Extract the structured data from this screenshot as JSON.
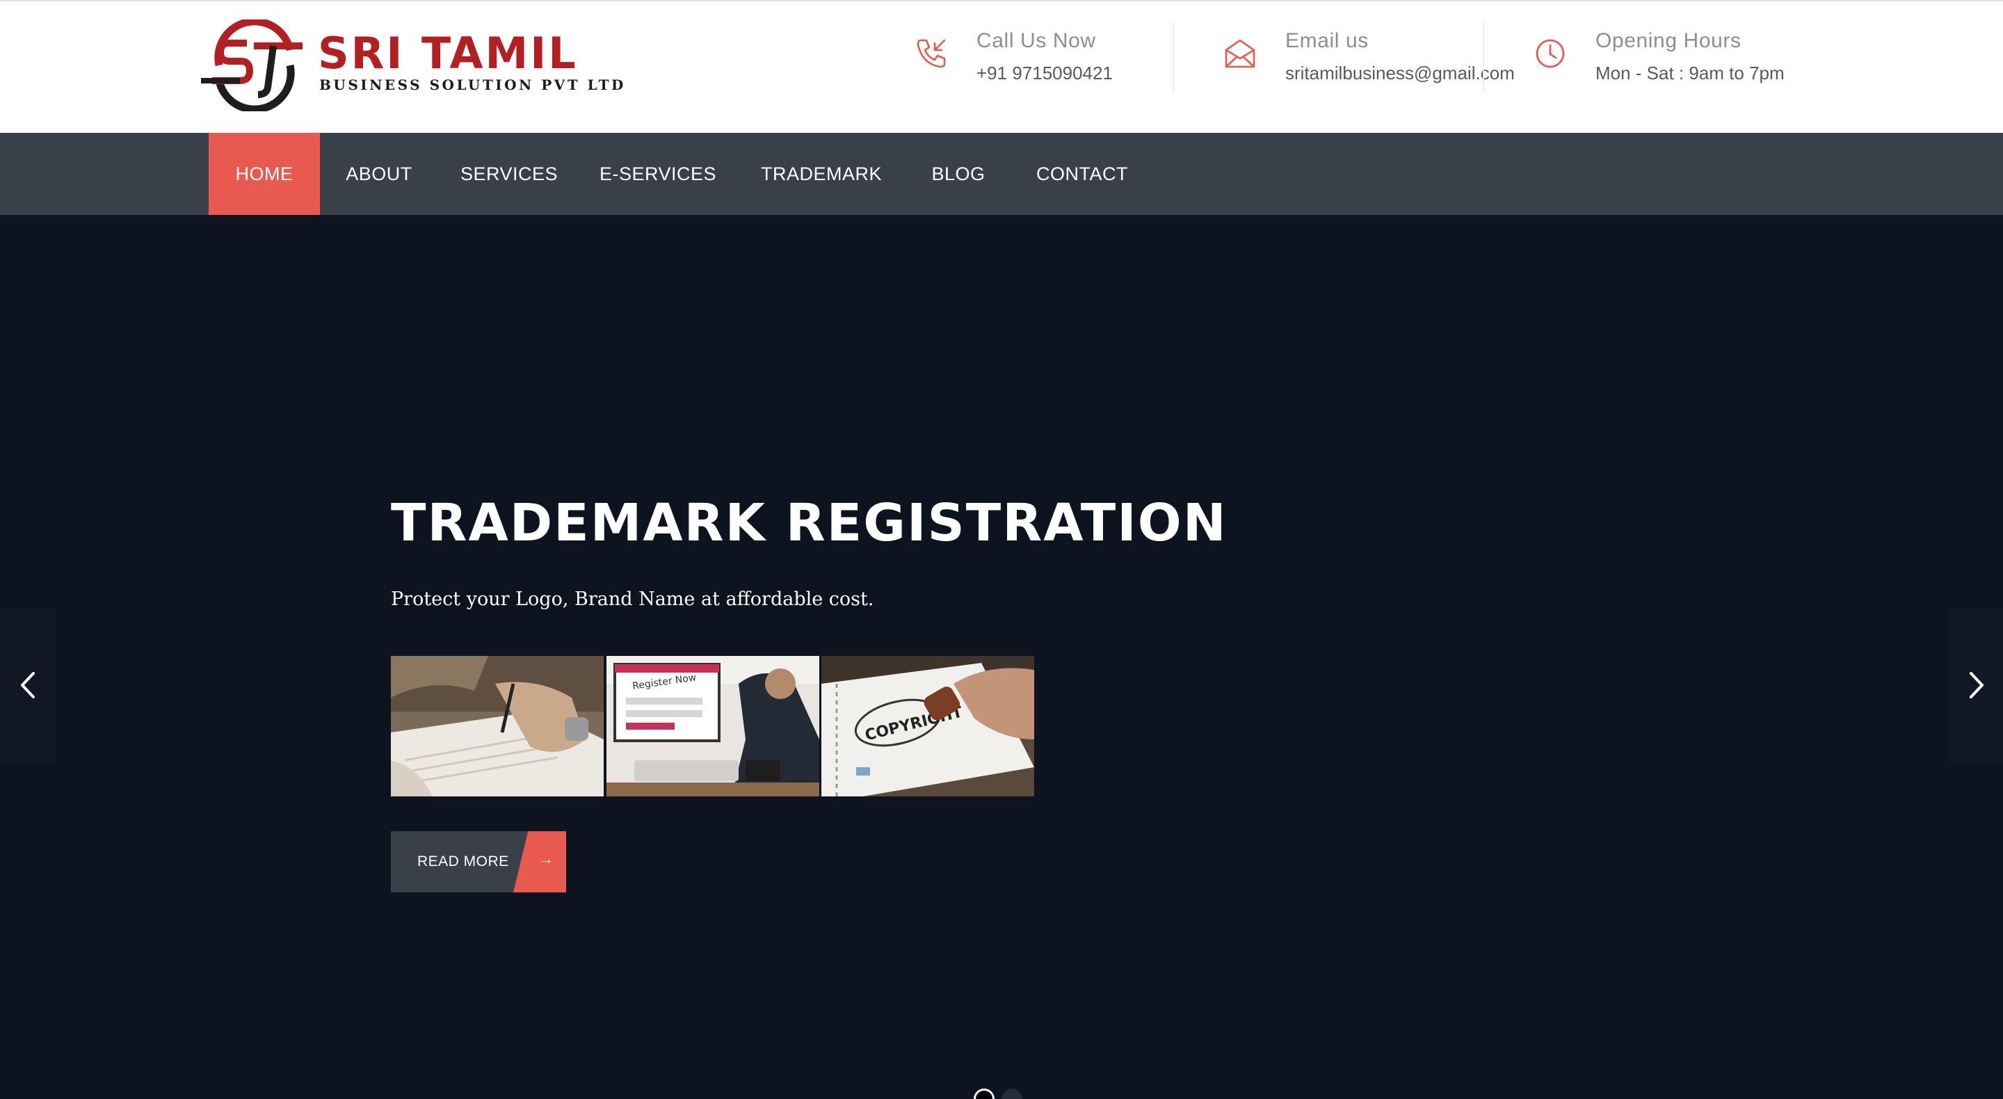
{
  "brand": {
    "name": "SRI TAMIL",
    "tagline": "BUSINESS SOLUTION PVT LTD",
    "primary_color": "#b32024",
    "accent_color": "#e85a50"
  },
  "contact": {
    "call": {
      "label": "Call Us Now",
      "value": "+91 9715090421",
      "icon": "phone-icon"
    },
    "email": {
      "label": "Email us",
      "value": "sritamilbusiness@gmail.com",
      "icon": "envelope-icon"
    },
    "hours": {
      "label": "Opening Hours",
      "value": "Mon - Sat : 9am to 7pm",
      "icon": "clock-icon"
    }
  },
  "nav": {
    "items": [
      {
        "label": "HOME",
        "active": true
      },
      {
        "label": "ABOUT"
      },
      {
        "label": "SERVICES"
      },
      {
        "label": "E-SERVICES"
      },
      {
        "label": "TRADEMARK"
      },
      {
        "label": "BLOG"
      },
      {
        "label": "CONTACT"
      }
    ]
  },
  "hero": {
    "title": "TRADEMARK REGISTRATION",
    "subtitle": "Protect your Logo, Brand Name at affordable cost.",
    "images": [
      {
        "alt": "signing document"
      },
      {
        "alt": "online registration",
        "screen_text": "Register Now"
      },
      {
        "alt": "copyright stamp",
        "stamp_text": "COPYRIGHT"
      }
    ],
    "button": {
      "label": "READ MORE",
      "arrow": "→"
    },
    "slider": {
      "prev_icon": "chevron-left-icon",
      "next_icon": "chevron-right-icon",
      "dots": 2,
      "active_dot": 1
    }
  }
}
